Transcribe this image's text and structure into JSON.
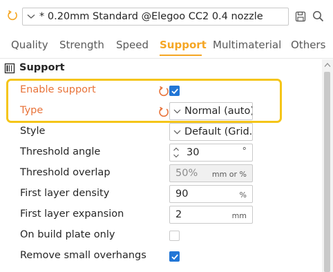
{
  "toolbar": {
    "preset_value": "* 0.20mm Standard @Elegoo CC2 0.4 nozzle"
  },
  "tabs": [
    {
      "label": "Quality",
      "active": false
    },
    {
      "label": "Strength",
      "active": false
    },
    {
      "label": "Speed",
      "active": false
    },
    {
      "label": "Support",
      "active": true
    },
    {
      "label": "Multimaterial",
      "active": false
    },
    {
      "label": "Others",
      "active": false
    }
  ],
  "section": {
    "title": "Support"
  },
  "settings": {
    "enable_support": {
      "label": "Enable support",
      "checked": true
    },
    "type": {
      "label": "Type",
      "value": "Normal (auto)"
    },
    "style": {
      "label": "Style",
      "value": "Default (Grid..."
    },
    "threshold_angle": {
      "label": "Threshold angle",
      "value": "30",
      "unit": "°"
    },
    "threshold_overlap": {
      "label": "Threshold overlap",
      "value": "50%",
      "unit": "mm or %"
    },
    "first_layer_density": {
      "label": "First layer density",
      "value": "90",
      "unit": "%"
    },
    "first_layer_expansion": {
      "label": "First layer expansion",
      "value": "2",
      "unit": "mm"
    },
    "on_build_plate_only": {
      "label": "On build plate only",
      "checked": false
    },
    "remove_small_overhangs": {
      "label": "Remove small overhangs",
      "checked": true
    }
  },
  "colors": {
    "accent": "#f5a623",
    "highlight_label": "#e8733a",
    "checkbox_on": "#2276d6",
    "annotation_box": "#f5c518"
  },
  "icons": [
    "reset-arrow-icon",
    "chevron-down-icon",
    "save-icon",
    "search-icon",
    "section-icon",
    "checkmark-icon",
    "spinner-icon",
    "scroll-up-arrow-icon"
  ]
}
